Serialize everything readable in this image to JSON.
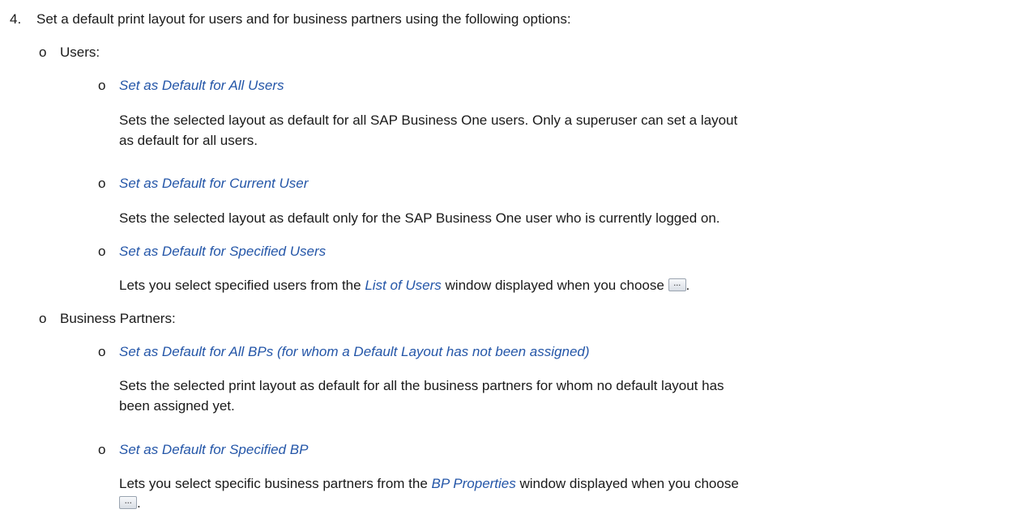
{
  "step": {
    "number": "4.",
    "text": "Set a default print layout for users and for business partners using the following options:"
  },
  "users": {
    "bullet": "o",
    "label": "Users:",
    "options": [
      {
        "bullet": "o",
        "title": "Set as Default for All Users",
        "desc_line1": "Sets the selected layout as default for all SAP Business One users. Only a superuser can set a layout",
        "desc_line2": "as default for all users."
      },
      {
        "bullet": "o",
        "title": "Set as Default for Current User",
        "desc_line1": "Sets the selected layout as default only for the SAP Business One user who is currently logged on."
      },
      {
        "bullet": "o",
        "title": "Set as Default for Specified Users",
        "desc_pre": "Lets you select specified users from the ",
        "desc_link": "List of Users",
        "desc_post": " window displayed when you choose ",
        "desc_end": "."
      }
    ]
  },
  "partners": {
    "bullet": "o",
    "label": "Business Partners:",
    "options": [
      {
        "bullet": "o",
        "title": "Set as Default for All BPs (for whom a Default Layout has not been assigned)",
        "desc_line1": "Sets the selected print layout as default for all the business partners for whom no default layout has",
        "desc_line2": "been assigned yet."
      },
      {
        "bullet": "o",
        "title": "Set as Default for Specified BP",
        "desc_pre": "Lets you select specific business partners from the ",
        "desc_link": "BP Properties",
        "desc_post": " window displayed when you choose",
        "desc_end": "."
      }
    ]
  },
  "icons": {
    "choose_button": "ellipsis-button-icon"
  }
}
